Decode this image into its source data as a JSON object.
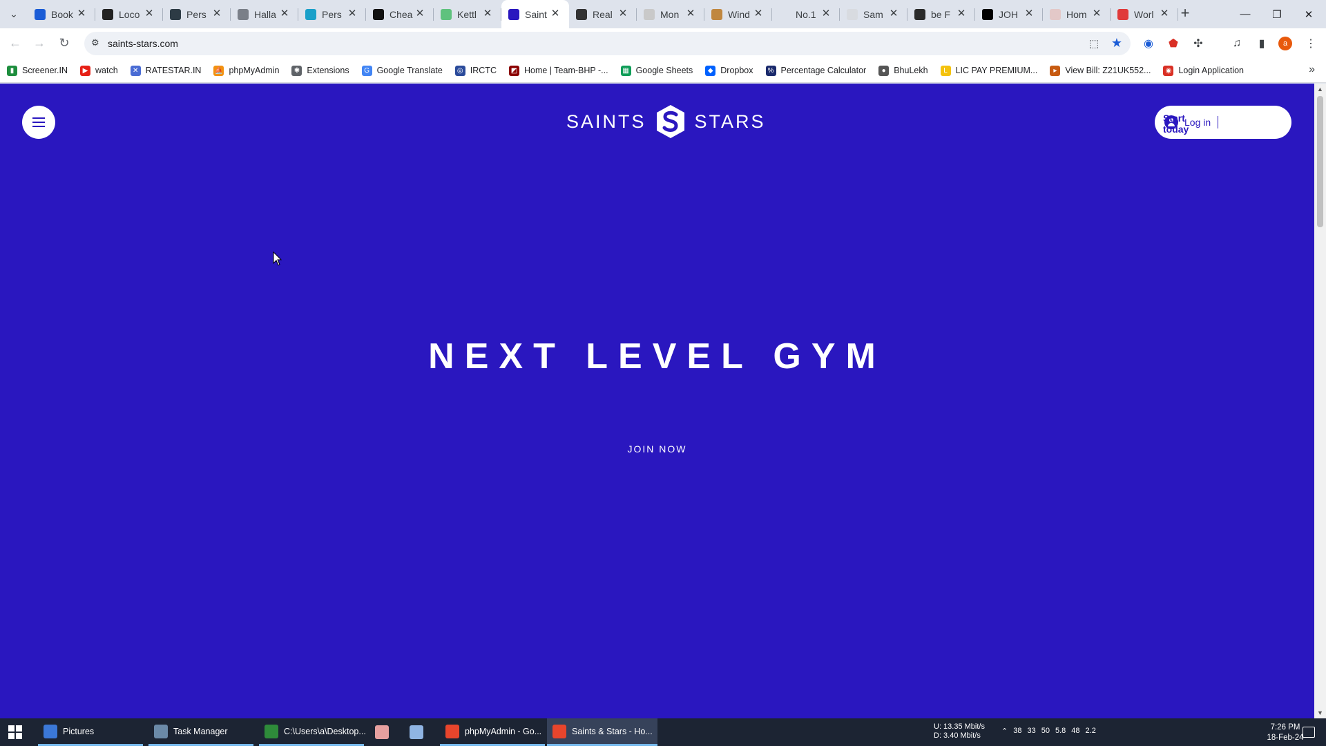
{
  "browser": {
    "tabs": [
      {
        "title": "Book",
        "color": "#1a5cd6"
      },
      {
        "title": "Loco",
        "color": "#222222"
      },
      {
        "title": "Pers",
        "color": "#2d3b45"
      },
      {
        "title": "Halla",
        "color": "#7a7f88"
      },
      {
        "title": "Pers",
        "color": "#1aa0c9"
      },
      {
        "title": "Chea",
        "color": "#111111"
      },
      {
        "title": "Kettl",
        "color": "#5fc27e"
      },
      {
        "title": "Saint",
        "color": "#2a17bf",
        "active": true
      },
      {
        "title": "Real",
        "color": "#333333"
      },
      {
        "title": "Mon",
        "color": "#c9c9c9"
      },
      {
        "title": "Wind",
        "color": "#c0873f"
      },
      {
        "title": "No.1",
        "color": "#dee3ec"
      },
      {
        "title": "Sam",
        "color": "#d8dbe0"
      },
      {
        "title": "be F",
        "color": "#2a2a2a"
      },
      {
        "title": "JOH",
        "color": "#000000"
      },
      {
        "title": "Hom",
        "color": "#e3c8c8"
      },
      {
        "title": "Worl",
        "color": "#e03a3a"
      }
    ],
    "close_glyph": "✕",
    "new_tab_glyph": "+",
    "window_controls": {
      "minimize": "—",
      "restore": "❐",
      "close": "✕"
    },
    "url": "saints-stars.com",
    "profile_initial": "a"
  },
  "bookmarks": [
    {
      "label": "Screener.IN",
      "color": "#1e8e3e",
      "glyph": "▮"
    },
    {
      "label": "watch",
      "color": "#e62117",
      "glyph": "▶"
    },
    {
      "label": "RATESTAR.IN",
      "color": "#4a6cd4",
      "glyph": "✕"
    },
    {
      "label": "phpMyAdmin",
      "color": "#f29111",
      "glyph": "⛵"
    },
    {
      "label": "Extensions",
      "color": "#5f6368",
      "glyph": "✱"
    },
    {
      "label": "Google Translate",
      "color": "#4285f4",
      "glyph": "G"
    },
    {
      "label": "IRCTC",
      "color": "#2b4b9b",
      "glyph": "◎"
    },
    {
      "label": "Home | Team-BHP -...",
      "color": "#8b0000",
      "glyph": "◩"
    },
    {
      "label": "Google Sheets",
      "color": "#0f9d58",
      "glyph": "▦"
    },
    {
      "label": "Dropbox",
      "color": "#0061fe",
      "glyph": "◆"
    },
    {
      "label": "Percentage Calculator",
      "color": "#1a2a6c",
      "glyph": "%"
    },
    {
      "label": "BhuLekh",
      "color": "#555555",
      "glyph": "●"
    },
    {
      "label": "LIC PAY PREMIUM...",
      "color": "#f4c20d",
      "glyph": "L"
    },
    {
      "label": "View Bill: Z21UK552...",
      "color": "#c75b12",
      "glyph": "▸"
    },
    {
      "label": "Login Application",
      "color": "#d93025",
      "glyph": "◉"
    }
  ],
  "bookmarks_more": "»",
  "site": {
    "brand_left": "SAINTS",
    "brand_right": "STARS",
    "login_label": "Log in",
    "start_label": "Start today",
    "hero_title": "NEXT LEVEL GYM",
    "cta_label": "JOIN NOW",
    "background_color": "#2a17bf"
  },
  "taskbar": {
    "apps": [
      {
        "label": "Pictures",
        "color": "#3b78d8",
        "state": "running"
      },
      {
        "label": "Task Manager",
        "color": "#6b8aa8",
        "state": "running"
      },
      {
        "label": "C:\\Users\\a\\Desktop...",
        "color": "#2e8b3a",
        "state": "running"
      },
      {
        "label": "",
        "color": "#e6a0a0",
        "state": "idle"
      },
      {
        "label": "",
        "color": "#8fb4e3",
        "state": "idle"
      },
      {
        "label": "phpMyAdmin - Go...",
        "color": "#e8452c",
        "state": "running"
      },
      {
        "label": "Saints & Stars - Ho...",
        "color": "#e8452c",
        "state": "active"
      }
    ],
    "net_up": "U:     13.35 Mbit/s",
    "net_down": "D:       3.40 Mbit/s",
    "tray_numbers": [
      "38",
      "33",
      "50",
      "5.8",
      "48",
      "2.2"
    ],
    "time": "7:26 PM",
    "date": "18-Feb-24"
  }
}
